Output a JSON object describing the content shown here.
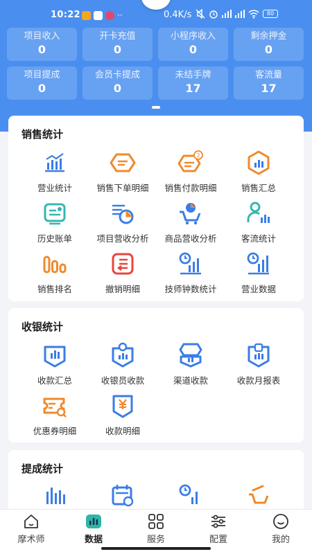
{
  "status_bar": {
    "time": "10:22",
    "network_speed": "0.4K/s",
    "battery": "80"
  },
  "summary_stats": [
    {
      "label": "项目收入",
      "value": "0"
    },
    {
      "label": "开卡充值",
      "value": "0"
    },
    {
      "label": "小程序收入",
      "value": "0"
    },
    {
      "label": "剩余押金",
      "value": "0"
    },
    {
      "label": "项目提成",
      "value": "0"
    },
    {
      "label": "会员卡提成",
      "value": "0"
    },
    {
      "label": "未结手牌",
      "value": "17"
    },
    {
      "label": "客流量",
      "value": "17"
    }
  ],
  "sales_section": {
    "title": "销售统计",
    "items": [
      {
        "label": "营业统计",
        "icon": "bar-chart-icon"
      },
      {
        "label": "销售下单明细",
        "icon": "order-tag-icon"
      },
      {
        "label": "销售付款明细",
        "icon": "payment-tag-icon",
        "badge": "2"
      },
      {
        "label": "销售汇总",
        "icon": "hexagon-chart-icon"
      },
      {
        "label": "历史账单",
        "icon": "bill-history-icon"
      },
      {
        "label": "项目营收分析",
        "icon": "pie-analysis-icon"
      },
      {
        "label": "商品营收分析",
        "icon": "cart-analysis-icon"
      },
      {
        "label": "客流统计",
        "icon": "customer-flow-icon"
      },
      {
        "label": "销售排名",
        "icon": "ranking-icon"
      },
      {
        "label": "撤销明细",
        "icon": "undo-detail-icon"
      },
      {
        "label": "技师钟数统计",
        "icon": "clock-stats-icon"
      },
      {
        "label": "营业数据",
        "icon": "business-data-icon"
      }
    ]
  },
  "cashier_section": {
    "title": "收银统计",
    "items": [
      {
        "label": "收款汇总",
        "icon": "collection-summary-icon"
      },
      {
        "label": "收银员收款",
        "icon": "cashier-collection-icon"
      },
      {
        "label": "渠道收款",
        "icon": "channel-collection-icon"
      },
      {
        "label": "收款月报表",
        "icon": "monthly-report-icon"
      },
      {
        "label": "优惠券明细",
        "icon": "coupon-detail-icon"
      },
      {
        "label": "收款明细",
        "icon": "yuan-detail-icon"
      }
    ]
  },
  "commission_section": {
    "title": "提成统计",
    "items": [
      {
        "label": "",
        "icon": "commission-bar-icon"
      },
      {
        "label": "",
        "icon": "calendar-clock-icon"
      },
      {
        "label": "",
        "icon": "clock-chart-icon"
      },
      {
        "label": "",
        "icon": "cart-commission-icon"
      }
    ]
  },
  "tabbar": [
    {
      "label": "摩术师",
      "icon": "home-icon",
      "active": false
    },
    {
      "label": "数据",
      "icon": "data-icon",
      "active": true
    },
    {
      "label": "服务",
      "icon": "grid-icon",
      "active": false
    },
    {
      "label": "配置",
      "icon": "settings-sliders-icon",
      "active": false
    },
    {
      "label": "我的",
      "icon": "profile-smile-icon",
      "active": false
    }
  ],
  "colors": {
    "header_blue": "#4a8fef",
    "icon_blue": "#3a7de6",
    "icon_orange": "#f0892b",
    "icon_teal": "#35b7b0",
    "icon_red": "#e8453c"
  }
}
